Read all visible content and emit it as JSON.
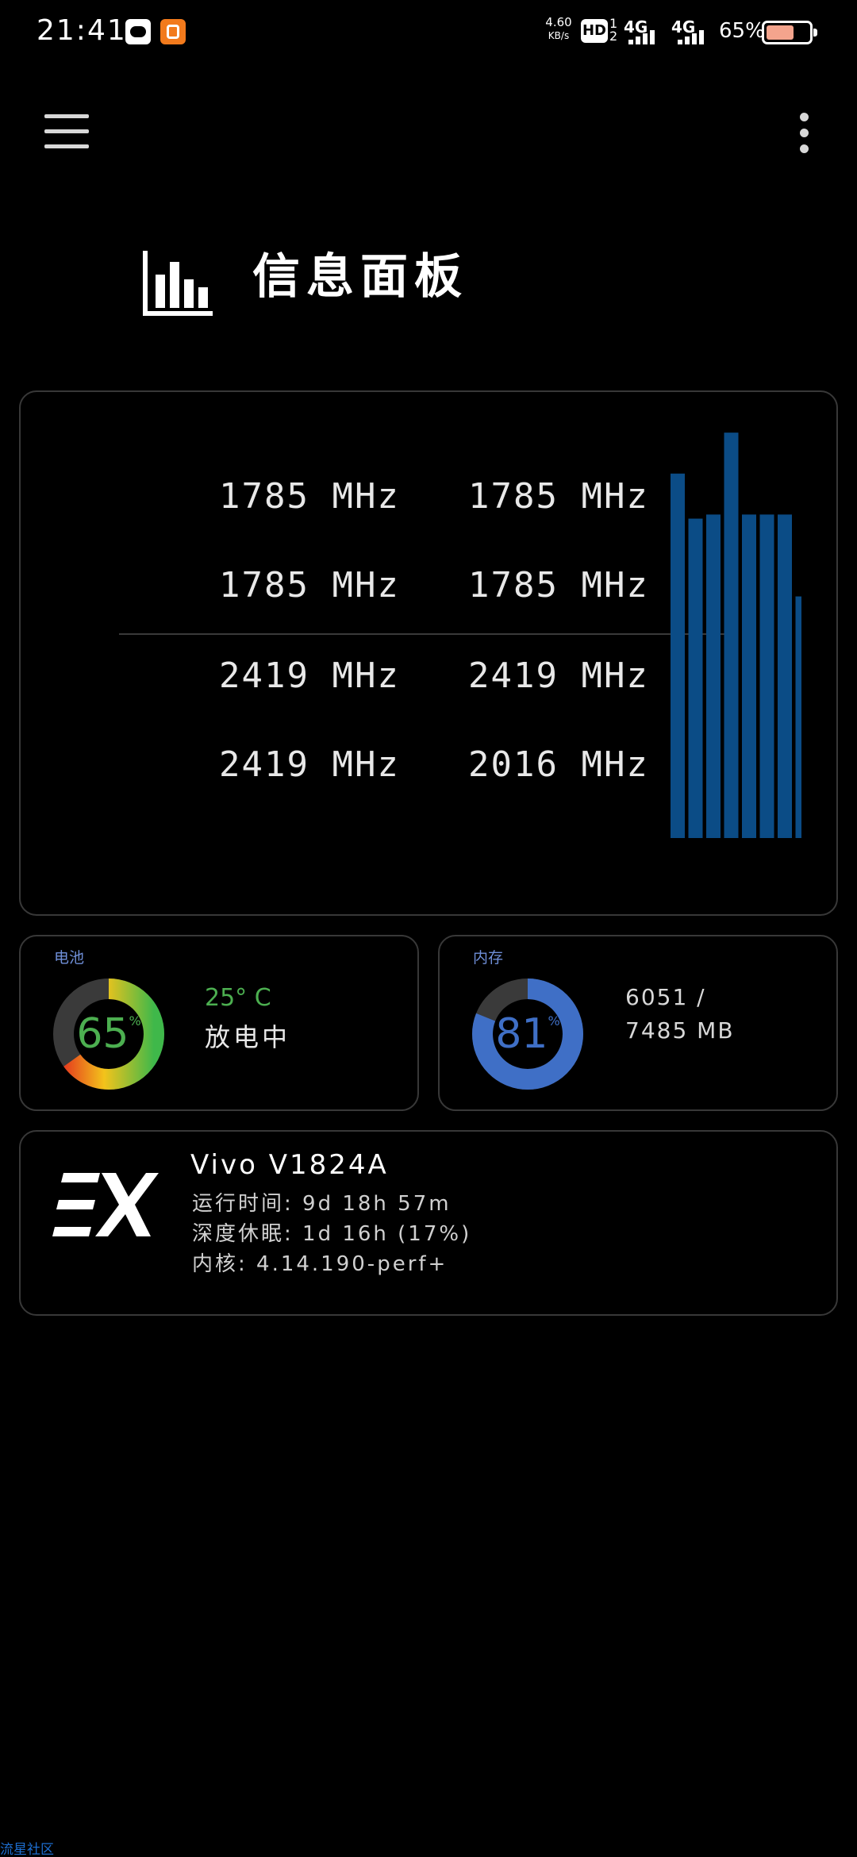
{
  "status_bar": {
    "time": "21:41",
    "net_speed_value": "4.60",
    "net_speed_unit": "KB/s",
    "hd_label": "HD",
    "sim_slots": "1\n2",
    "net1": "4G",
    "net2": "4G",
    "battery_text": "65%",
    "battery_fraction": 0.65
  },
  "app_bar": {
    "menu_icon": "hamburger-menu-icon",
    "more_icon": "more-vertical-icon"
  },
  "header": {
    "icon": "bar-chart-icon",
    "title": "信息面板"
  },
  "cpu": {
    "frequencies": [
      "1785 MHz",
      "1785 MHz",
      "1785 MHz",
      "1785 MHz",
      "2419 MHz",
      "2419 MHz",
      "2419 MHz",
      "2016 MHz"
    ],
    "load_fractions": [
      0.89,
      0.78,
      0.79,
      0.99,
      0.79,
      0.79,
      0.79,
      0.59
    ],
    "bar_color": "#0b4c86"
  },
  "battery": {
    "label": "电池",
    "percent": "65",
    "percent_sign": "%",
    "percent_value": 65,
    "temperature": "25° C",
    "status": "放电中",
    "text_color": "#4caf50"
  },
  "memory": {
    "label": "内存",
    "percent": "81",
    "percent_sign": "%",
    "percent_value": 81,
    "used": "6051 /",
    "total": "7485 MB",
    "ring_color": "#3f6fc6"
  },
  "device": {
    "logo": "EX",
    "name": "Vivo V1824A",
    "uptime": "运行时间: 9d 18h 57m",
    "deep_sleep": "深度休眠: 1d 16h (17%)",
    "kernel": "内核: 4.14.190-perf+"
  },
  "watermark": "流星社区"
}
